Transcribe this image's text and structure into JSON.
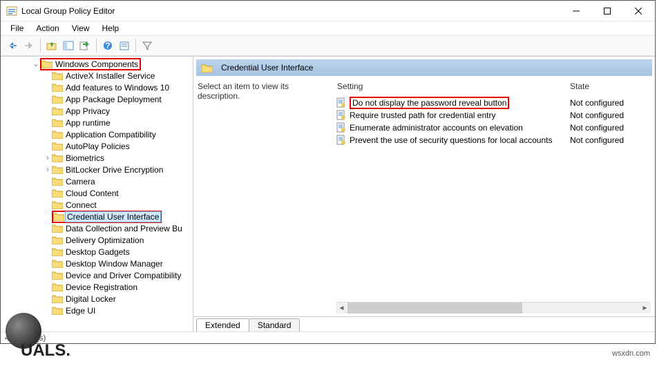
{
  "window": {
    "title": "Local Group Policy Editor"
  },
  "menus": [
    "File",
    "Action",
    "View",
    "Help"
  ],
  "tree": {
    "root_label": "Windows Components",
    "children": [
      "ActiveX Installer Service",
      "Add features to Windows 10",
      "App Package Deployment",
      "App Privacy",
      "App runtime",
      "Application Compatibility",
      "AutoPlay Policies",
      "Biometrics",
      "BitLocker Drive Encryption",
      "Camera",
      "Cloud Content",
      "Connect",
      "Credential User Interface",
      "Data Collection and Preview Bu",
      "Delivery Optimization",
      "Desktop Gadgets",
      "Desktop Window Manager",
      "Device and Driver Compatibility",
      "Device Registration",
      "Digital Locker",
      "Edge UI"
    ],
    "selected_index": 12,
    "expandable_indexes": [
      7,
      8
    ]
  },
  "right": {
    "header": "Credential User Interface",
    "description": "Select an item to view its description.",
    "columns": {
      "setting": "Setting",
      "state": "State"
    },
    "rows": [
      {
        "name": "Do not display the password reveal button",
        "state": "Not configured",
        "highlight": true
      },
      {
        "name": "Require trusted path for credential entry",
        "state": "Not configured",
        "highlight": false
      },
      {
        "name": "Enumerate administrator accounts on elevation",
        "state": "Not configured",
        "highlight": false
      },
      {
        "name": "Prevent the use of security questions for local accounts",
        "state": "Not configured",
        "highlight": false
      }
    ]
  },
  "tabs": [
    "Extended",
    "Standard"
  ],
  "active_tab": 0,
  "status": "4 setting(s)",
  "watermark": "wsxdn.com",
  "overlay_text": "UALS."
}
